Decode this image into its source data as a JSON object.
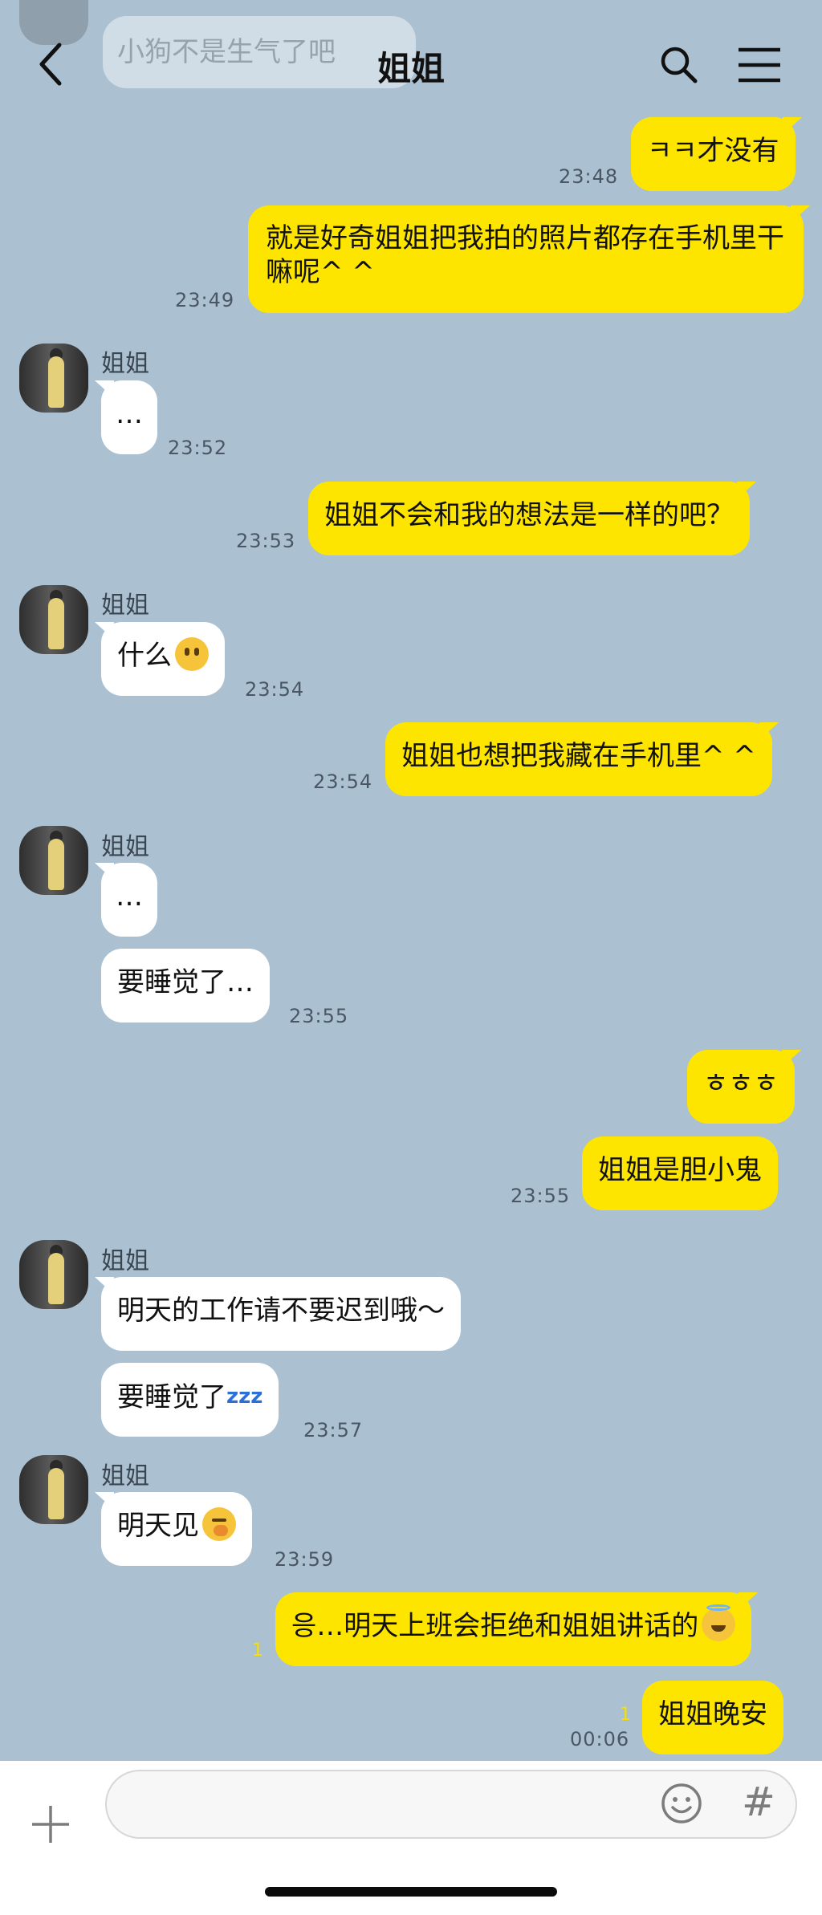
{
  "header": {
    "title": "姐姐",
    "ghost_preview": "小狗不是生气了吧"
  },
  "contact_name": "姐姐",
  "messages": [
    {
      "text": "ㅋㅋ才没有",
      "time": "23:48"
    },
    {
      "text": "就是好奇姐姐把我拍的照片都存在手机里干嘛呢^ ^",
      "time": "23:49"
    },
    {
      "text": "…",
      "time": "23:52"
    },
    {
      "text": "姐姐不会和我的想法是一样的吧？",
      "time": "23:53"
    },
    {
      "text": "什么",
      "time": "23:54",
      "emoji": "neutral-face-emoji"
    },
    {
      "text": "姐姐也想把我藏在手机里^ ^",
      "time": "23:54"
    },
    {
      "text": "…"
    },
    {
      "text": "要睡觉了…",
      "time": "23:55"
    },
    {
      "text": "ㅎㅎㅎ"
    },
    {
      "text": "姐姐是胆小鬼",
      "time": "23:55"
    },
    {
      "text": "明天的工作请不要迟到哦～"
    },
    {
      "text": "要睡觉了",
      "time": "23:57",
      "suffix": "zzz"
    },
    {
      "text": "明天见",
      "time": "23:59",
      "emoji": "yawning-face-emoji"
    },
    {
      "text": "응…明天上班会拒绝和姐姐讲话的",
      "unread": "1",
      "emoji": "smiling-face-with-halo-emoji"
    },
    {
      "text": "姐姐晚安",
      "time": "00:06",
      "unread": "1"
    }
  ],
  "composer": {
    "placeholder": "",
    "hash_label": "#"
  },
  "colors": {
    "background": "#abc1d1",
    "my_bubble": "#fee500",
    "their_bubble": "#ffffff"
  },
  "icons": [
    "back-arrow-icon",
    "search-icon",
    "menu-icon",
    "plus-icon",
    "emoji-icon",
    "hash-icon"
  ]
}
